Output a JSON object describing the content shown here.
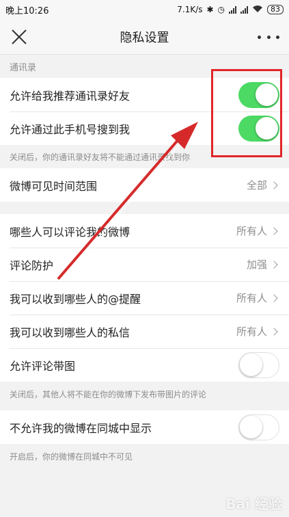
{
  "status_bar": {
    "time": "晚上10:26",
    "speed": "7.1K/s",
    "battery": "83",
    "icons": [
      "bluetooth-icon",
      "alarm-icon",
      "signal-icon",
      "signal-icon",
      "wifi-icon",
      "battery-icon"
    ]
  },
  "nav": {
    "title": "隐私设置",
    "close_icon": "close-icon",
    "more_icon": "more-icon"
  },
  "sections": {
    "contacts_label": "通讯录",
    "recommend_friends": {
      "label": "允许给我推荐通讯录好友",
      "toggle": "on"
    },
    "find_by_phone": {
      "label": "允许通过此手机号搜到我",
      "toggle": "on"
    },
    "contacts_note": "关闭后，你的通讯录好友将不能通过通讯录找到你",
    "weibo_visible": {
      "label": "微博可见时间范围",
      "value": "全部"
    },
    "who_comment": {
      "label": "哪些人可以评论我的微博",
      "value": "所有人"
    },
    "comment_protect": {
      "label": "评论防护",
      "value": "加强"
    },
    "mention": {
      "label": "我可以收到哪些人的@提醒",
      "value": "所有人"
    },
    "private_msg": {
      "label": "我可以收到哪些人的私信",
      "value": "所有人"
    },
    "comment_image": {
      "label": "允许评论带图",
      "toggle": "off"
    },
    "comment_image_note": "关闭后，其他人将不能在你的微博下发布带图片的评论",
    "same_city": {
      "label": "不允许我的微博在同城中显示",
      "toggle": "off"
    },
    "same_city_note": "开启后，你的微博在同城中不可见"
  },
  "colors": {
    "toggle_on": "#4cd964",
    "annotation": "#e0262a"
  },
  "watermark": "Bai 经验"
}
